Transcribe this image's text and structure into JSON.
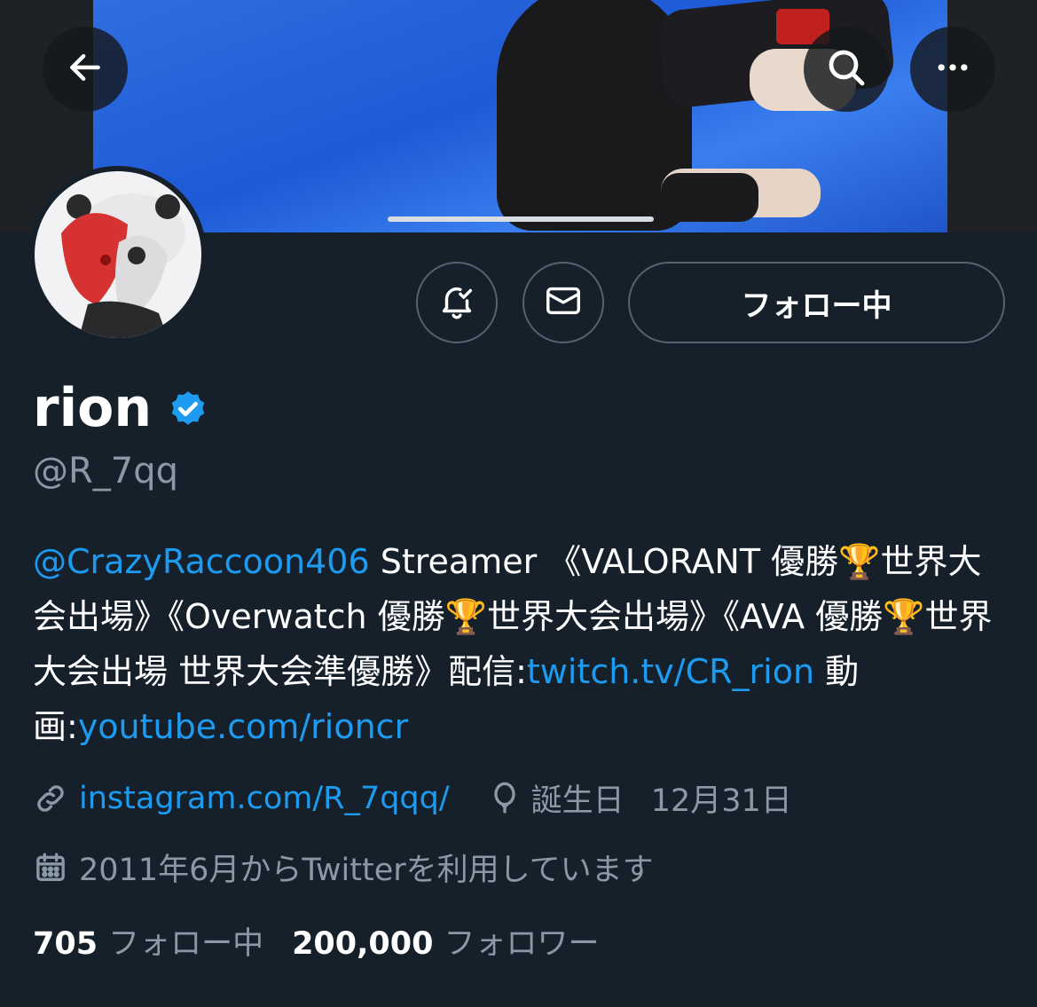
{
  "header": {
    "back_icon": "arrow-left-icon",
    "search_icon": "search-icon",
    "more_icon": "more-horizontal-icon"
  },
  "profile": {
    "name": "rion",
    "verified": true,
    "handle": "@R_7qq",
    "actions": {
      "notify_icon": "bell-check-icon",
      "message_icon": "mail-icon",
      "follow_label": "フォロー中"
    },
    "bio": {
      "mention": "@CrazyRaccoon406",
      "part1": " Streamer 《VALORANT 優勝🏆世界大会出場》《Overwatch 優勝🏆世界大会出場》《AVA 優勝🏆世界大会出場 世界大会準優勝》配信:",
      "link1": "twitch.tv/CR_rion",
      "part2": " 動画:",
      "link2": "youtube.com/rioncr"
    },
    "website": "instagram.com/R_7qqq/",
    "birthday_label": "誕生日",
    "birthday_value": "12月31日",
    "joined": "2011年6月からTwitterを利用しています",
    "following_count": "705",
    "following_label": "フォロー中",
    "followers_count": "200,000",
    "followers_label": "フォロワー"
  },
  "colors": {
    "background": "#15202b",
    "accent": "#1d9bf0",
    "secondary_text": "#8b98a5",
    "border": "#536471"
  }
}
